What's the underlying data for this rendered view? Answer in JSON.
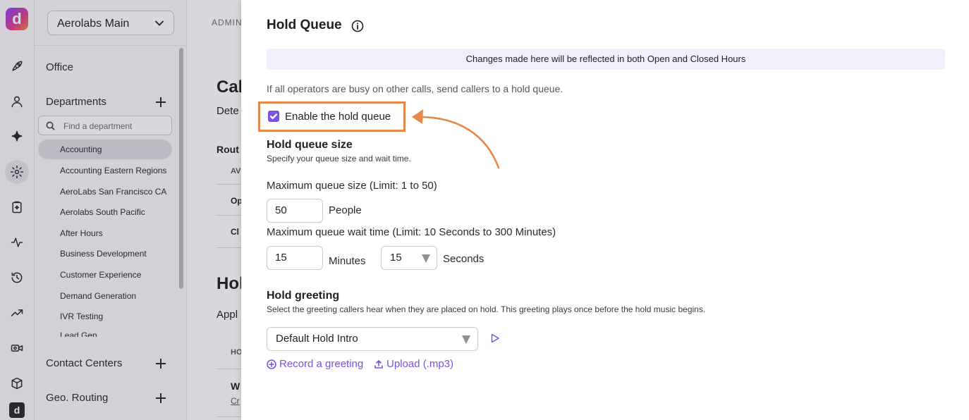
{
  "rail": {
    "logo_letter": "d",
    "bottom_logo_letter": "d",
    "icons": [
      "rocket-icon",
      "person-icon",
      "sparkle-icon",
      "gear-icon",
      "clipboard-icon",
      "activity-icon",
      "history-icon",
      "trending-icon",
      "video-icon",
      "box-icon"
    ]
  },
  "sidebar": {
    "workspace": "Aerolabs Main",
    "office": "Office",
    "departments_heading": "Departments",
    "search_placeholder": "Find a department",
    "departments": [
      "Accounting",
      "Accounting Eastern Regions",
      "AeroLabs San Francisco CA",
      "Aerolabs South Pacific",
      "After Hours",
      "Business Development",
      "Customer Experience",
      "Demand Generation",
      "IVR Testing",
      "Lead Gen"
    ],
    "selected_department": "Accounting",
    "contact_centers": "Contact Centers",
    "geo_routing": "Geo. Routing"
  },
  "main_peek": {
    "admin": "ADMIN",
    "call_title": "Cal",
    "call_sub": "Dete",
    "routing": "Rout",
    "av": "AV",
    "op": "Op",
    "cl": "Cl",
    "hold_title": "Hol",
    "appl": "Appl",
    "ho": "HO",
    "w": "W",
    "cr": "Cr"
  },
  "panel": {
    "title": "Hold Queue",
    "banner": "Changes made here will be reflected in both Open and Closed Hours",
    "description": "If all operators are busy on other calls, send callers to a hold queue.",
    "enable_label": "Enable the hold queue",
    "enable_checked": true,
    "size_heading": "Hold queue size",
    "size_sub": "Specify your queue size and wait time.",
    "max_size_label": "Maximum queue size (Limit: 1 to 50)",
    "max_size_value": "50",
    "people_unit": "People",
    "max_wait_label": "Maximum queue wait time (Limit: 10 Seconds to 300 Minutes)",
    "minutes_value": "15",
    "minutes_unit": "Minutes",
    "seconds_value": "15",
    "seconds_unit": "Seconds",
    "greeting_heading": "Hold greeting",
    "greeting_sub": "Select the greeting callers hear when they are placed on hold. This greeting plays once before the hold music begins.",
    "greeting_value": "Default Hold Intro",
    "record_link": "Record a greeting",
    "upload_link": "Upload (.mp3)"
  },
  "colors": {
    "accent": "#7c52e0",
    "highlight": "#e8874a",
    "banner_bg": "#eff0fb"
  }
}
